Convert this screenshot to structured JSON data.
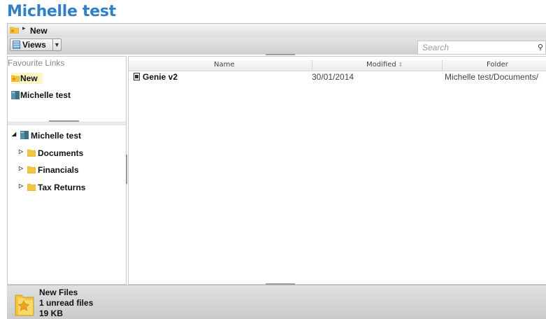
{
  "app": {
    "title": "Michelle test"
  },
  "breadcrumb": {
    "current": "New"
  },
  "toolbar": {
    "views_label": "Views"
  },
  "search": {
    "placeholder": "Search",
    "value": ""
  },
  "favourites": {
    "header": "Favourite Links",
    "items": [
      {
        "label": "New",
        "icon": "folder-star-icon",
        "selected": true
      },
      {
        "label": "Michelle test",
        "icon": "cabinet-icon",
        "selected": false
      }
    ]
  },
  "tree": {
    "root": {
      "label": "Michelle test",
      "icon": "cabinet-icon",
      "expanded": true
    },
    "children": [
      {
        "label": "Documents",
        "icon": "folder-icon",
        "expanded": false
      },
      {
        "label": "Financials",
        "icon": "folder-icon",
        "expanded": false
      },
      {
        "label": "Tax Returns",
        "icon": "folder-icon",
        "expanded": false
      }
    ]
  },
  "table": {
    "columns": [
      "Name",
      "Modified",
      "Folder"
    ],
    "rows": [
      {
        "name": "Genie v2",
        "modified": "30/01/2014",
        "folder": "Michelle test/Documents/",
        "icon": "document-icon"
      }
    ]
  },
  "footer": {
    "title": "New Files",
    "unread": "1 unread files",
    "size": "19 KB"
  },
  "colors": {
    "title": "#2f7fc9",
    "folder": "#f5c542",
    "selection": "#fff5c6"
  }
}
